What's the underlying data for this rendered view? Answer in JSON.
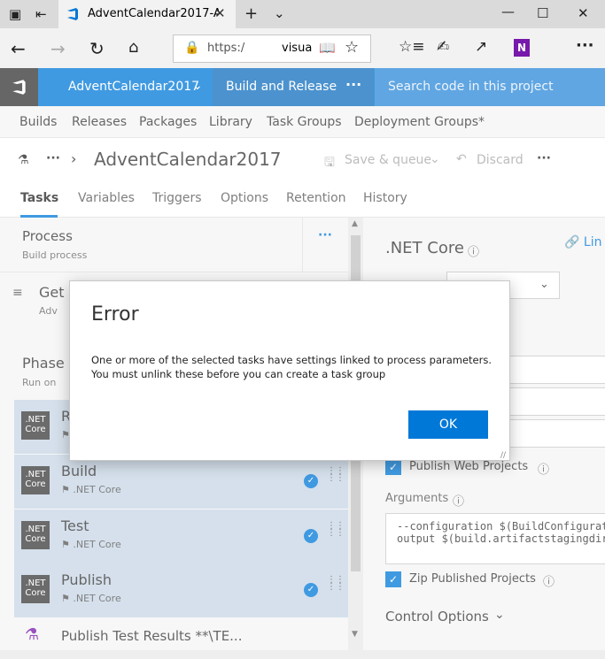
{
  "browser": {
    "tab_title": "AdventCalendar2017-A!",
    "url_prefix": "https:/",
    "url_suffix": "visua",
    "icons": [
      "tab-preview-icon",
      "set-aside-tabs-icon",
      "new-tab-icon",
      "tab-list-icon",
      "minimize-icon",
      "maximize-icon",
      "close-icon",
      "back-icon",
      "forward-icon",
      "refresh-icon",
      "home-icon",
      "lock-icon",
      "reading-view-icon",
      "favorite-icon",
      "favorites-hub-icon",
      "pen-icon",
      "share-icon",
      "onenote-icon",
      "more-icon"
    ]
  },
  "header": {
    "project": "AdventCalendar2017",
    "hub": "Build and Release",
    "more": "···",
    "search_placeholder": "Search code in this project"
  },
  "subnav": {
    "items": [
      "Builds",
      "Releases",
      "Packages",
      "Library",
      "Task Groups",
      "Deployment Groups*"
    ]
  },
  "titlebar": {
    "ellipsis": "···",
    "title": "AdventCalendar2017-",
    "save_queue": "Save & queue",
    "discard": "Discard",
    "more": "···"
  },
  "tabs": [
    "Tasks",
    "Variables",
    "Triggers",
    "Options",
    "Retention",
    "History"
  ],
  "left": {
    "process_title": "Process",
    "process_sub": "Build process",
    "get_sources_title": "Get s",
    "get_sources_sub": "Adv",
    "phase_title": "Phase",
    "phase_sub": "Run on",
    "tasks": [
      {
        "name": "R",
        "sub": "",
        "badge_top": ".NET",
        "badge_bottom": "Core"
      },
      {
        "name": "Build",
        "sub": ".NET Core",
        "badge_top": ".NET",
        "badge_bottom": "Core"
      },
      {
        "name": "Test",
        "sub": ".NET Core",
        "badge_top": ".NET",
        "badge_bottom": "Core"
      },
      {
        "name": "Publish",
        "sub": ".NET Core",
        "badge_top": ".NET",
        "badge_bottom": "Core"
      }
    ],
    "publish_test_results": "Publish Test Results **\\TE..."
  },
  "right": {
    "heading": ".NET Core",
    "link_label": "Lin",
    "publish_web": "Publish Web Projects",
    "arguments_label": "Arguments",
    "arguments_line1": "--configuration $(BuildConfiguration",
    "arguments_line2": "output $(build.artifactstagingdirecto",
    "zip_published": "Zip Published Projects",
    "control_options": "Control Options"
  },
  "dialog": {
    "title": "Error",
    "message": "One or more of the selected tasks have settings linked to process parameters. You must unlink these before you can create a task group",
    "ok": "OK"
  },
  "colors": {
    "accent": "#0078d7",
    "header": "#0078d7",
    "selected_row": "#c7d6e6"
  }
}
